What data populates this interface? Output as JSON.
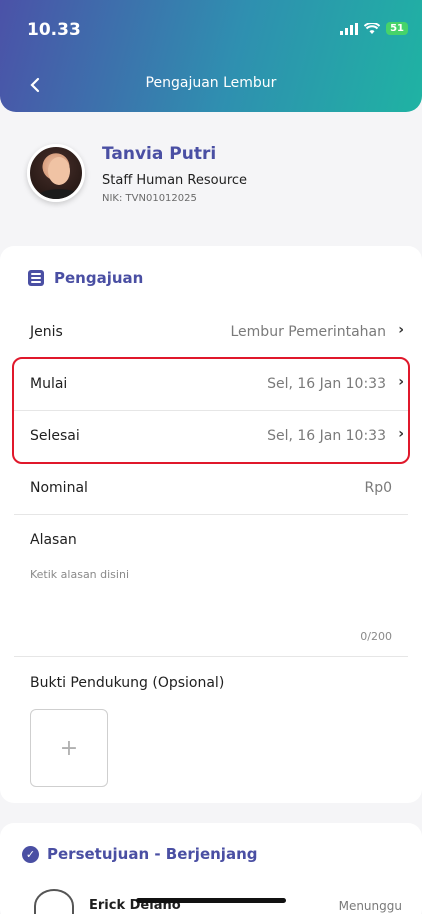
{
  "status_bar": {
    "time": "10.33",
    "battery": "51"
  },
  "header": {
    "title": "Pengajuan Lembur"
  },
  "profile": {
    "name": "Tanvia Putri",
    "role": "Staff Human Resource",
    "nik": "NIK: TVN01012025"
  },
  "form": {
    "section_title": "Pengajuan",
    "rows": [
      {
        "label": "Jenis",
        "value": "Lembur Pemerintahan"
      },
      {
        "label": "Mulai",
        "value": "Sel, 16 Jan 10:33"
      },
      {
        "label": "Selesai",
        "value": "Sel, 16 Jan 10:33"
      },
      {
        "label": "Nominal",
        "value": "Rp0"
      }
    ],
    "alasan_label": "Alasan",
    "alasan_placeholder": "Ketik alasan disini",
    "alasan_counter": "0/200",
    "bukti_label": "Bukti Pendukung (Opsional)",
    "upload_symbol": "+"
  },
  "approval": {
    "section_title": "Persetujuan - Berjenjang",
    "approver_name": "Erick Delano",
    "approver_status": "Menunggu"
  },
  "colors": {
    "accent": "#4a4fa3",
    "highlight": "#e0182b"
  }
}
